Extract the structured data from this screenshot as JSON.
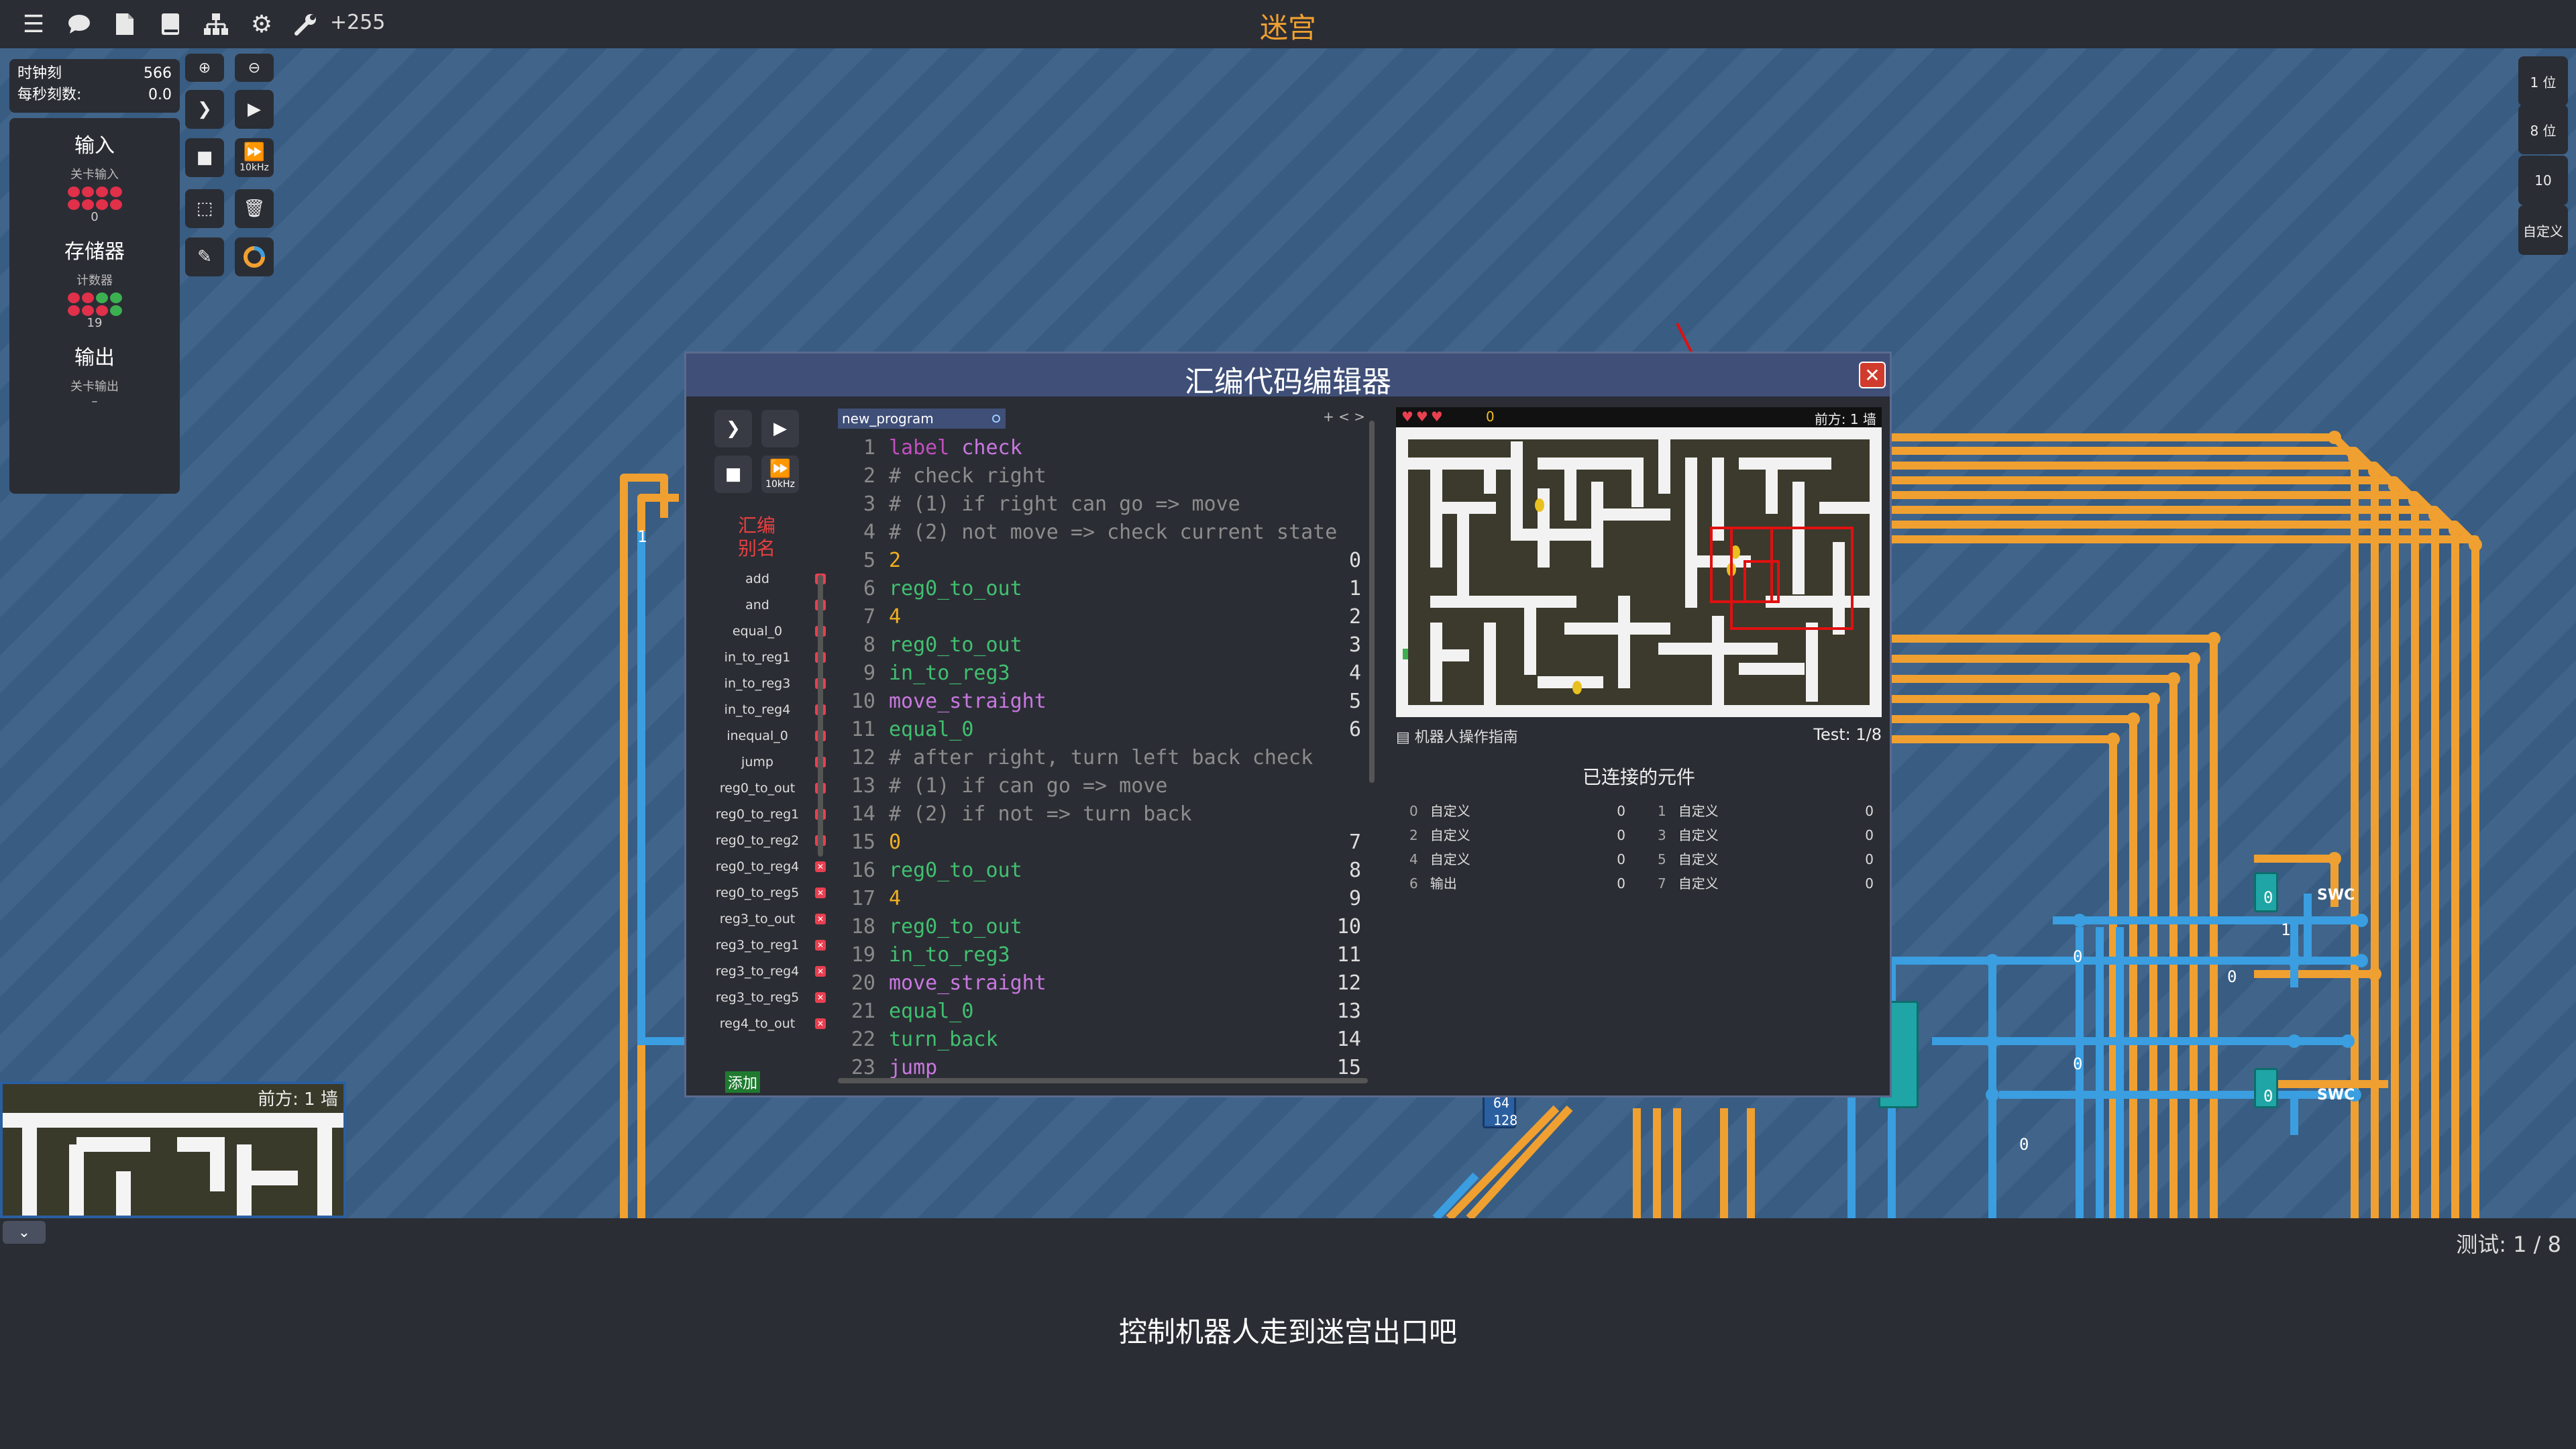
{
  "topbar": {
    "title": "迷宫",
    "count": "+255",
    "icons": [
      "menu-icon",
      "chat-icon",
      "file-icon",
      "book-icon",
      "hierarchy-icon",
      "gear-icon",
      "wrench-icon"
    ]
  },
  "clock": {
    "tick_label": "时钟刻",
    "tick_value": "566",
    "rate_label": "每秒刻数:",
    "rate_value": "0.0"
  },
  "palette": {
    "input_heading": "输入",
    "input_sub": "关卡输入",
    "input_value": "0",
    "storage_heading": "存储器",
    "storage_sub": "计数器",
    "storage_value": "19",
    "output_heading": "输出",
    "output_sub": "关卡输出",
    "output_value": "–"
  },
  "tools": {
    "speed_label": "10kHz"
  },
  "right_buttons": [
    "1 位",
    "8 位",
    "10",
    "自定义"
  ],
  "editor": {
    "title": "汇编代码编辑器",
    "close": "✕",
    "speed_label": "10kHz",
    "alias_title_1": "汇编",
    "alias_title_2": "别名",
    "aliases": [
      "add",
      "and",
      "equal_0",
      "in_to_reg1",
      "in_to_reg3",
      "in_to_reg4",
      "inequal_0",
      "jump",
      "reg0_to_out",
      "reg0_to_reg1",
      "reg0_to_reg2",
      "reg0_to_reg4",
      "reg0_to_reg5",
      "reg3_to_out",
      "reg3_to_reg1",
      "reg3_to_reg4",
      "reg3_to_reg5",
      "reg4_to_out"
    ],
    "add_button": "添加",
    "file_tab": "new_program",
    "tab_arrows": "+ < >",
    "code": [
      {
        "n": "1",
        "text": "label check",
        "kind": "label",
        "addr": ""
      },
      {
        "n": "2",
        "text": "# check right",
        "kind": "comment",
        "addr": ""
      },
      {
        "n": "3",
        "text": "# (1) if right can go => move",
        "kind": "comment",
        "addr": ""
      },
      {
        "n": "4",
        "text": "# (2) not move => check current state",
        "kind": "comment",
        "addr": ""
      },
      {
        "n": "5",
        "text": "2",
        "kind": "num",
        "addr": "0"
      },
      {
        "n": "6",
        "text": "reg0_to_out",
        "kind": "instr",
        "addr": "1"
      },
      {
        "n": "7",
        "text": "4",
        "kind": "num",
        "addr": "2"
      },
      {
        "n": "8",
        "text": "reg0_to_out",
        "kind": "instr",
        "addr": "3"
      },
      {
        "n": "9",
        "text": "in_to_reg3",
        "kind": "instr",
        "addr": "4"
      },
      {
        "n": "10",
        "text": "move_straight",
        "kind": "ident",
        "addr": "5"
      },
      {
        "n": "11",
        "text": "equal_0",
        "kind": "instr",
        "addr": "6"
      },
      {
        "n": "12",
        "text": "# after right, turn left back check",
        "kind": "comment",
        "addr": ""
      },
      {
        "n": "13",
        "text": "# (1) if can go => move",
        "kind": "comment",
        "addr": ""
      },
      {
        "n": "14",
        "text": "# (2) if not => turn back",
        "kind": "comment",
        "addr": ""
      },
      {
        "n": "15",
        "text": "0",
        "kind": "num",
        "addr": "7"
      },
      {
        "n": "16",
        "text": "reg0_to_out",
        "kind": "instr",
        "addr": "8"
      },
      {
        "n": "17",
        "text": "4",
        "kind": "num",
        "addr": "9"
      },
      {
        "n": "18",
        "text": "reg0_to_out",
        "kind": "instr",
        "addr": "10"
      },
      {
        "n": "19",
        "text": "in_to_reg3",
        "kind": "instr",
        "addr": "11"
      },
      {
        "n": "20",
        "text": "move_straight",
        "kind": "ident",
        "addr": "12"
      },
      {
        "n": "21",
        "text": "equal_0",
        "kind": "instr",
        "addr": "13"
      },
      {
        "n": "22",
        "text": "turn_back",
        "kind": "instr",
        "addr": "14"
      },
      {
        "n": "23",
        "text": "jump",
        "kind": "ident",
        "addr": "15"
      }
    ],
    "robot": {
      "hearts": "♥♥♥",
      "coins": "0",
      "front": "前方: 1 墙",
      "guide": "机器人操作指南",
      "test": "Test: 1/8",
      "connected_title": "已连接的元件",
      "components": [
        {
          "id": "0",
          "name": "自定义",
          "value": "0"
        },
        {
          "id": "1",
          "name": "自定义",
          "value": "0"
        },
        {
          "id": "2",
          "name": "自定义",
          "value": "0"
        },
        {
          "id": "3",
          "name": "自定义",
          "value": "0"
        },
        {
          "id": "4",
          "name": "自定义",
          "value": "0"
        },
        {
          "id": "5",
          "name": "自定义",
          "value": "0"
        },
        {
          "id": "6",
          "name": "输出",
          "value": "0"
        },
        {
          "id": "7",
          "name": "自定义",
          "value": "0"
        }
      ]
    }
  },
  "minimaze": {
    "front": "前方: 1 墙"
  },
  "canvas_labels": {
    "swc": "SWC",
    "v64": "64",
    "v128": "128",
    "zero": "0",
    "one": "1"
  },
  "bottom": {
    "test_status": "测试: 1 / 8",
    "hint": "控制机器人走到迷宫出口吧",
    "collapse": "⌄"
  },
  "colors": {
    "wire_orange": "#f0a030",
    "wire_blue": "#3a9ee0",
    "panel": "#2b2d34",
    "title_bar": "#3f4f78"
  }
}
